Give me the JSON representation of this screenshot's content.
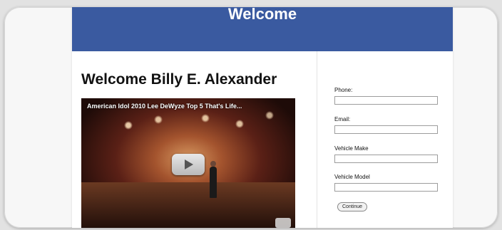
{
  "banner": {
    "title": "Welcome"
  },
  "main": {
    "heading": "Welcome Billy E. Alexander",
    "video": {
      "title": "American Idol 2010 Lee DeWyze Top 5 That's Life...",
      "play_icon": "play-icon"
    }
  },
  "form": {
    "phone_label": "Phone:",
    "phone_value": "",
    "email_label": "Email:",
    "email_value": "",
    "vehicle_make_label": "Vehicle Make",
    "vehicle_make_value": "",
    "vehicle_model_label": "Vehicle Model",
    "vehicle_model_value": "",
    "continue_label": "Continue"
  },
  "colors": {
    "banner": "#3a5aa0",
    "page_background": "#ffffff"
  }
}
